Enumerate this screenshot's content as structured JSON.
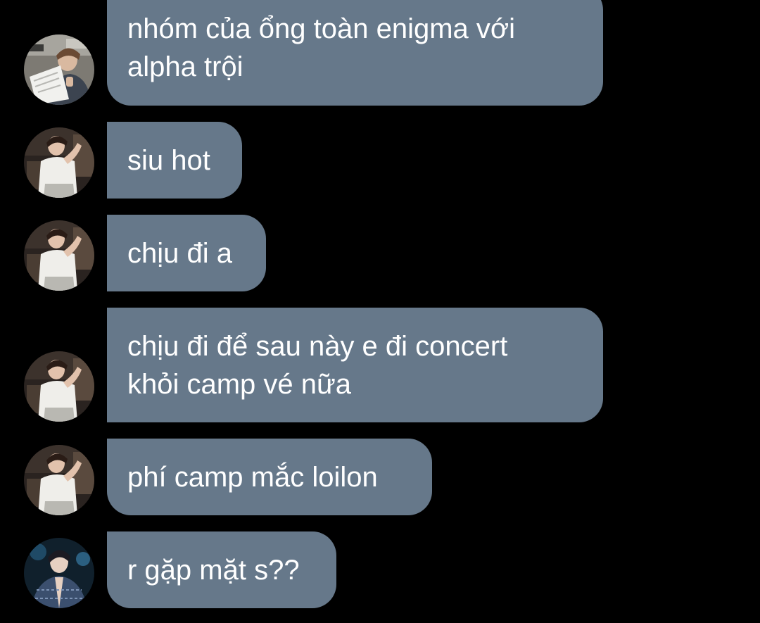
{
  "chat": {
    "colors": {
      "background": "#000000",
      "bubble": "#66788a",
      "text": "#ffffff"
    },
    "messages": [
      {
        "sender_avatar": "avatar-photo-man-reading",
        "lines": [
          "nhóm của ổng toàn enigma với",
          "alpha trội"
        ]
      },
      {
        "sender_avatar": "avatar-photo-white-shirt",
        "lines": [
          "siu hot"
        ]
      },
      {
        "sender_avatar": "avatar-photo-white-shirt",
        "lines": [
          "chịu đi a"
        ]
      },
      {
        "sender_avatar": "avatar-photo-white-shirt",
        "lines": [
          "chịu đi để sau này e đi concert",
          "khỏi camp vé nữa"
        ]
      },
      {
        "sender_avatar": "avatar-photo-white-shirt",
        "lines": [
          "phí camp mắc loilon"
        ]
      },
      {
        "sender_avatar": "avatar-photo-blue-jacket",
        "lines": [
          "r gặp mặt s??"
        ]
      }
    ]
  }
}
